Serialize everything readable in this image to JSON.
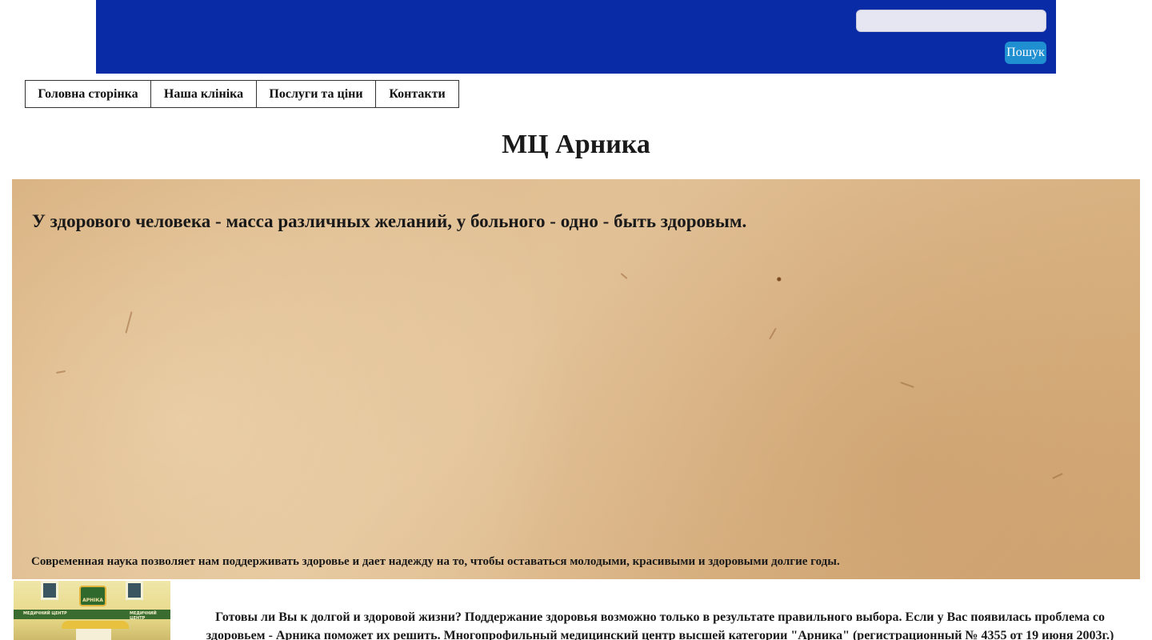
{
  "search": {
    "value": "",
    "placeholder": "",
    "button_label": "Пошук"
  },
  "nav": {
    "items": [
      {
        "label": "Головна сторінка"
      },
      {
        "label": "Наша клініка"
      },
      {
        "label": "Послуги та ціни"
      },
      {
        "label": "Контакти"
      }
    ]
  },
  "page": {
    "title": "МЦ Арника"
  },
  "hero": {
    "quote": "У здорового человека - масса различных желаний, у больного - одно - быть здоровым.",
    "caption": "Современная наука позволяет нам поддерживать здоровье и дает надежду на то, чтобы оставаться молодыми, красивыми и здоровыми долгие годы."
  },
  "clinic_photo": {
    "sign_left": "МЕДИЧНИЙ ЦЕНТР",
    "logo": "АРНІКА",
    "sign_right": "МЕДИЧНИЙ ЦЕНТР"
  },
  "intro": {
    "text": "Готовы ли Вы к долгой и здоровой жизни? Поддержание здоровья возможно только в результате правильного выбора. Если у Вас появилась проблема со здоровьем - Арника поможет их решить. Многопрофильный медицинский центр высшей категории \"Арника\" (регистрационный № 4355 от 19 июня 2003г.)"
  },
  "colors": {
    "header_bg": "#0a2ba6",
    "search_button_bg": "#1f8fd1",
    "hero_bg": "#d8b383"
  }
}
